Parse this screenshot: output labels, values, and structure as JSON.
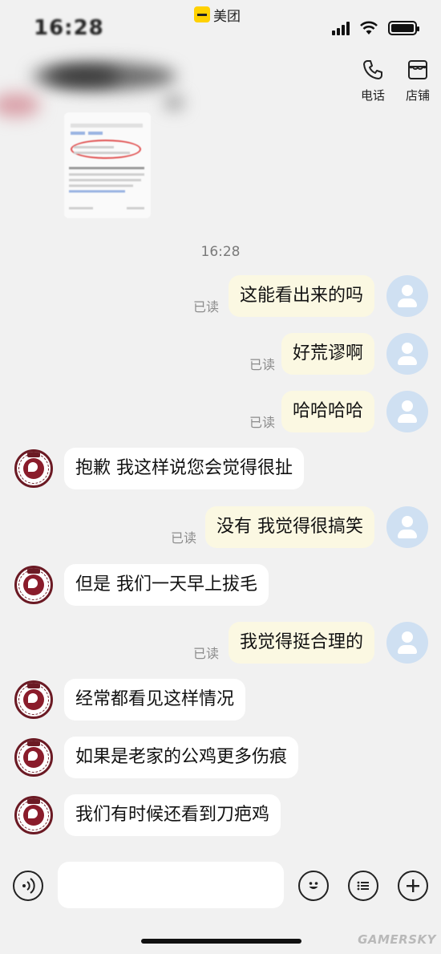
{
  "status_bar": {
    "time": "16:28",
    "app_name": "美团"
  },
  "header": {
    "actions": [
      {
        "label": "电话",
        "icon": "phone-icon"
      },
      {
        "label": "店铺",
        "icon": "store-icon"
      }
    ]
  },
  "timestamp": "16:28",
  "messages": [
    {
      "from": "me",
      "text": "这能看出来的吗",
      "read": "已读"
    },
    {
      "from": "me",
      "text": "好荒谬啊",
      "read": "已读"
    },
    {
      "from": "me",
      "text": "哈哈哈哈",
      "read": "已读"
    },
    {
      "from": "merchant",
      "text": "抱歉 我这样说您会觉得很扯"
    },
    {
      "from": "me",
      "text": "没有 我觉得很搞笑",
      "read": "已读"
    },
    {
      "from": "merchant",
      "text": "但是 我们一天早上拔毛"
    },
    {
      "from": "me",
      "text": "我觉得挺合理的",
      "read": "已读"
    },
    {
      "from": "merchant",
      "text": "经常都看见这样情况"
    },
    {
      "from": "merchant",
      "text": "如果是老家的公鸡更多伤痕"
    },
    {
      "from": "merchant",
      "text": "我们有时候还看到刀疤鸡"
    }
  ],
  "input_bar": {
    "placeholder": ""
  },
  "watermark": "GAMERSKY"
}
